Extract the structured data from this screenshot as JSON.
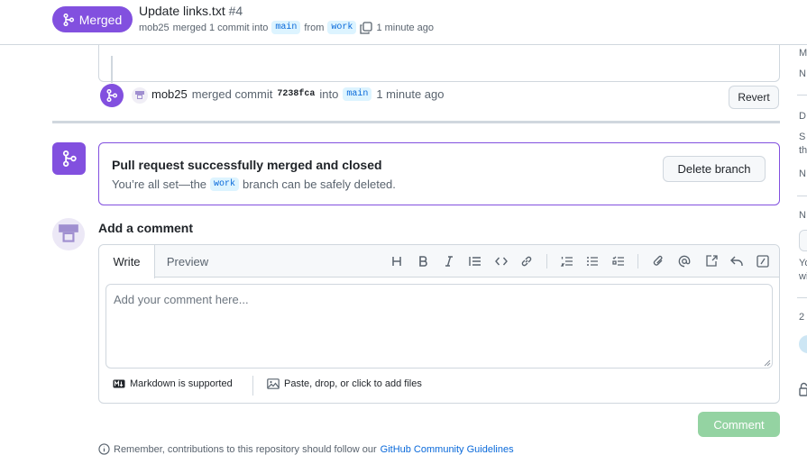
{
  "header": {
    "badge_label": "Merged",
    "title": "Update links.txt",
    "number": "#4",
    "author": "mob25",
    "merged_text": "merged 1 commit into",
    "base_branch": "main",
    "from_text": "from",
    "head_branch": "work",
    "time": "1 minute ago"
  },
  "event": {
    "user": "mob25",
    "action": "merged commit",
    "sha": "7238fca",
    "into_text": "into",
    "branch": "main",
    "time": "1 minute ago",
    "revert_label": "Revert"
  },
  "merged_box": {
    "title": "Pull request successfully merged and closed",
    "desc_before": "You’re all set—the",
    "branch": "work",
    "desc_after": "branch can be safely deleted.",
    "delete_label": "Delete branch"
  },
  "comment": {
    "title": "Add a comment",
    "tabs": [
      "Write",
      "Preview"
    ],
    "placeholder": "Add your comment here...",
    "markdown_note": "Markdown is supported",
    "files_note": "Paste, drop, or click to add files",
    "submit_label": "Comment"
  },
  "footer": {
    "note_before": "Remember, contributions to this repository should follow our",
    "note_link": "GitHub Community Guidelines"
  },
  "sidebar_slivers": [
    "M",
    "N",
    "D",
    "S",
    "th",
    "N",
    "N",
    "Yo",
    "wi",
    "2"
  ],
  "colors": {
    "merged_purple": "#8250df",
    "code_bg": "#ddf4ff",
    "code_fg": "#0969da",
    "comment_disabled": "#94d3a2"
  }
}
